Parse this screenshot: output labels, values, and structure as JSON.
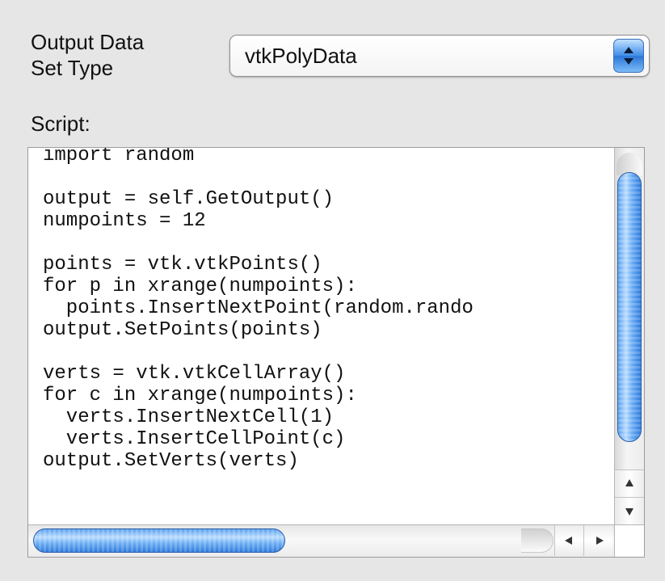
{
  "output_type": {
    "label": "Output Data\nSet Type",
    "selected": "vtkPolyData"
  },
  "script": {
    "label": "Script:",
    "code": "import random\n\noutput = self.GetOutput()\nnumpoints = 12\n\npoints = vtk.vtkPoints()\nfor p in xrange(numpoints):\n  points.InsertNextPoint(random.rando\noutput.SetPoints(points)\n\nverts = vtk.vtkCellArray()\nfor c in xrange(numpoints):\n  verts.InsertNextCell(1)\n  verts.InsertCellPoint(c)\noutput.SetVerts(verts)"
  },
  "icons": {
    "stepper": "up-down-stepper-icon",
    "scroll_up": "arrow-up-icon",
    "scroll_down": "arrow-down-icon",
    "scroll_left": "arrow-left-icon",
    "scroll_right": "arrow-right-icon"
  },
  "colors": {
    "accent": "#3f8de8",
    "background": "#e6e6e6"
  }
}
